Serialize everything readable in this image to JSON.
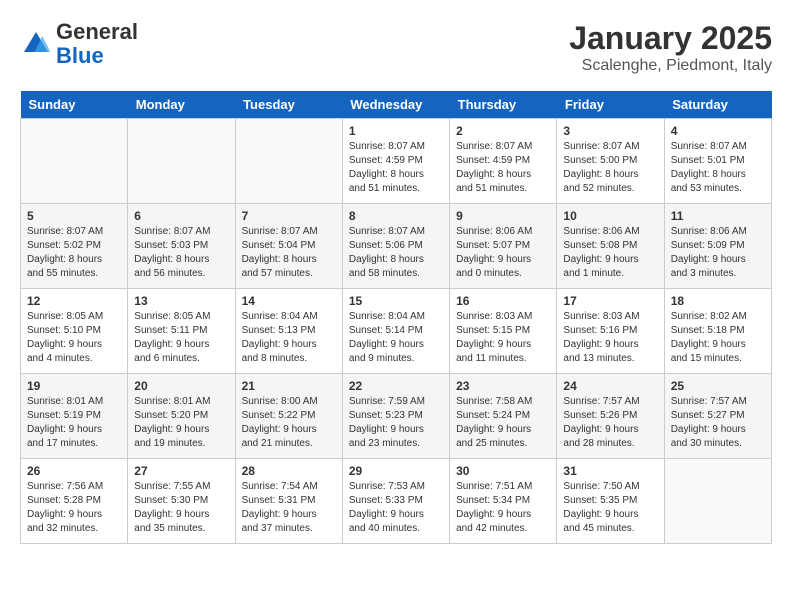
{
  "header": {
    "logo_general": "General",
    "logo_blue": "Blue",
    "month": "January 2025",
    "location": "Scalenghe, Piedmont, Italy"
  },
  "weekdays": [
    "Sunday",
    "Monday",
    "Tuesday",
    "Wednesday",
    "Thursday",
    "Friday",
    "Saturday"
  ],
  "weeks": [
    [
      {
        "day": "",
        "info": ""
      },
      {
        "day": "",
        "info": ""
      },
      {
        "day": "",
        "info": ""
      },
      {
        "day": "1",
        "info": "Sunrise: 8:07 AM\nSunset: 4:59 PM\nDaylight: 8 hours and 51 minutes."
      },
      {
        "day": "2",
        "info": "Sunrise: 8:07 AM\nSunset: 4:59 PM\nDaylight: 8 hours and 51 minutes."
      },
      {
        "day": "3",
        "info": "Sunrise: 8:07 AM\nSunset: 5:00 PM\nDaylight: 8 hours and 52 minutes."
      },
      {
        "day": "4",
        "info": "Sunrise: 8:07 AM\nSunset: 5:01 PM\nDaylight: 8 hours and 53 minutes."
      }
    ],
    [
      {
        "day": "5",
        "info": "Sunrise: 8:07 AM\nSunset: 5:02 PM\nDaylight: 8 hours and 55 minutes."
      },
      {
        "day": "6",
        "info": "Sunrise: 8:07 AM\nSunset: 5:03 PM\nDaylight: 8 hours and 56 minutes."
      },
      {
        "day": "7",
        "info": "Sunrise: 8:07 AM\nSunset: 5:04 PM\nDaylight: 8 hours and 57 minutes."
      },
      {
        "day": "8",
        "info": "Sunrise: 8:07 AM\nSunset: 5:06 PM\nDaylight: 8 hours and 58 minutes."
      },
      {
        "day": "9",
        "info": "Sunrise: 8:06 AM\nSunset: 5:07 PM\nDaylight: 9 hours and 0 minutes."
      },
      {
        "day": "10",
        "info": "Sunrise: 8:06 AM\nSunset: 5:08 PM\nDaylight: 9 hours and 1 minute."
      },
      {
        "day": "11",
        "info": "Sunrise: 8:06 AM\nSunset: 5:09 PM\nDaylight: 9 hours and 3 minutes."
      }
    ],
    [
      {
        "day": "12",
        "info": "Sunrise: 8:05 AM\nSunset: 5:10 PM\nDaylight: 9 hours and 4 minutes."
      },
      {
        "day": "13",
        "info": "Sunrise: 8:05 AM\nSunset: 5:11 PM\nDaylight: 9 hours and 6 minutes."
      },
      {
        "day": "14",
        "info": "Sunrise: 8:04 AM\nSunset: 5:13 PM\nDaylight: 9 hours and 8 minutes."
      },
      {
        "day": "15",
        "info": "Sunrise: 8:04 AM\nSunset: 5:14 PM\nDaylight: 9 hours and 9 minutes."
      },
      {
        "day": "16",
        "info": "Sunrise: 8:03 AM\nSunset: 5:15 PM\nDaylight: 9 hours and 11 minutes."
      },
      {
        "day": "17",
        "info": "Sunrise: 8:03 AM\nSunset: 5:16 PM\nDaylight: 9 hours and 13 minutes."
      },
      {
        "day": "18",
        "info": "Sunrise: 8:02 AM\nSunset: 5:18 PM\nDaylight: 9 hours and 15 minutes."
      }
    ],
    [
      {
        "day": "19",
        "info": "Sunrise: 8:01 AM\nSunset: 5:19 PM\nDaylight: 9 hours and 17 minutes."
      },
      {
        "day": "20",
        "info": "Sunrise: 8:01 AM\nSunset: 5:20 PM\nDaylight: 9 hours and 19 minutes."
      },
      {
        "day": "21",
        "info": "Sunrise: 8:00 AM\nSunset: 5:22 PM\nDaylight: 9 hours and 21 minutes."
      },
      {
        "day": "22",
        "info": "Sunrise: 7:59 AM\nSunset: 5:23 PM\nDaylight: 9 hours and 23 minutes."
      },
      {
        "day": "23",
        "info": "Sunrise: 7:58 AM\nSunset: 5:24 PM\nDaylight: 9 hours and 25 minutes."
      },
      {
        "day": "24",
        "info": "Sunrise: 7:57 AM\nSunset: 5:26 PM\nDaylight: 9 hours and 28 minutes."
      },
      {
        "day": "25",
        "info": "Sunrise: 7:57 AM\nSunset: 5:27 PM\nDaylight: 9 hours and 30 minutes."
      }
    ],
    [
      {
        "day": "26",
        "info": "Sunrise: 7:56 AM\nSunset: 5:28 PM\nDaylight: 9 hours and 32 minutes."
      },
      {
        "day": "27",
        "info": "Sunrise: 7:55 AM\nSunset: 5:30 PM\nDaylight: 9 hours and 35 minutes."
      },
      {
        "day": "28",
        "info": "Sunrise: 7:54 AM\nSunset: 5:31 PM\nDaylight: 9 hours and 37 minutes."
      },
      {
        "day": "29",
        "info": "Sunrise: 7:53 AM\nSunset: 5:33 PM\nDaylight: 9 hours and 40 minutes."
      },
      {
        "day": "30",
        "info": "Sunrise: 7:51 AM\nSunset: 5:34 PM\nDaylight: 9 hours and 42 minutes."
      },
      {
        "day": "31",
        "info": "Sunrise: 7:50 AM\nSunset: 5:35 PM\nDaylight: 9 hours and 45 minutes."
      },
      {
        "day": "",
        "info": ""
      }
    ]
  ]
}
